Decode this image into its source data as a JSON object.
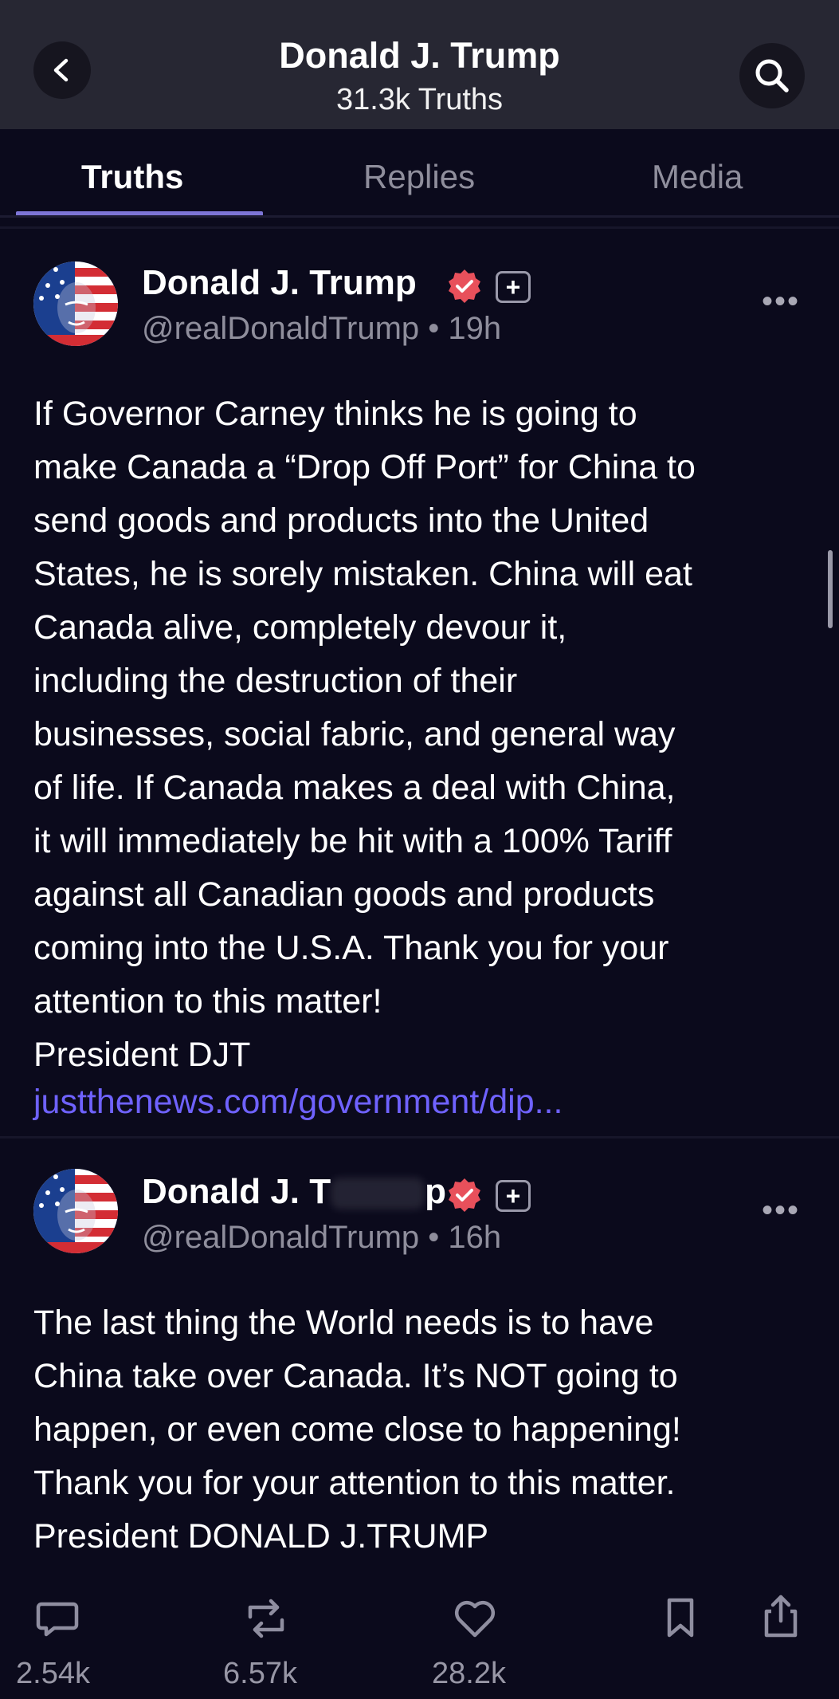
{
  "header": {
    "title": "Donald J. Trump",
    "subtitle": "31.3k Truths"
  },
  "tabs": [
    {
      "label": "Truths",
      "active": true
    },
    {
      "label": "Replies",
      "active": false
    },
    {
      "label": "Media",
      "active": false
    }
  ],
  "posts": [
    {
      "author": "Donald J. Trump",
      "handle": "@realDonaldTrump",
      "time": "19h",
      "handle_line": "@realDonaldTrump • 19h",
      "lines": [
        "If Governor Carney thinks he is going to",
        "make Canada a “Drop Off Port” for China to",
        "send goods and products into the United",
        "States, he is sorely mistaken. China will eat",
        "Canada alive, completely devour it,",
        "including the destruction of their",
        "businesses, social fabric, and general way",
        "of life. If Canada makes a deal with China,",
        "it will immediately be hit with a 100% Tariff",
        "against all Canadian goods and products",
        "coming into the U.S.A. Thank you for your",
        "attention to this matter!",
        "President DJT"
      ],
      "link": "justthenews.com/government/dip..."
    },
    {
      "author": "Donald J. T",
      "author_partial_end": "p",
      "handle": "@realDonaldTrump",
      "time": "16h",
      "handle_line": "@realDonaldTrump • 16h",
      "lines": [
        "The last thing the World needs is to have",
        "China take over Canada. It’s NOT going to",
        "happen, or even come close to happening!",
        "Thank you for your attention to this matter.",
        "President DONALD J.TRUMP"
      ],
      "actions": {
        "replies": "2.54k",
        "retruths": "6.57k",
        "likes": "28.2k"
      }
    }
  ],
  "icons": {
    "back": "chevron-left-icon",
    "search": "search-icon",
    "verified": "verified-badge-icon",
    "plus": "plus-icon",
    "more": "more-icon",
    "reply": "reply-icon",
    "retruth": "retruth-icon",
    "like": "heart-icon",
    "bookmark": "bookmark-icon",
    "share": "share-icon"
  },
  "colors": {
    "background": "#0b0a1c",
    "header": "#272733",
    "accent": "#7d75d6",
    "link": "#6f62ff",
    "verified": "#e8505b"
  }
}
